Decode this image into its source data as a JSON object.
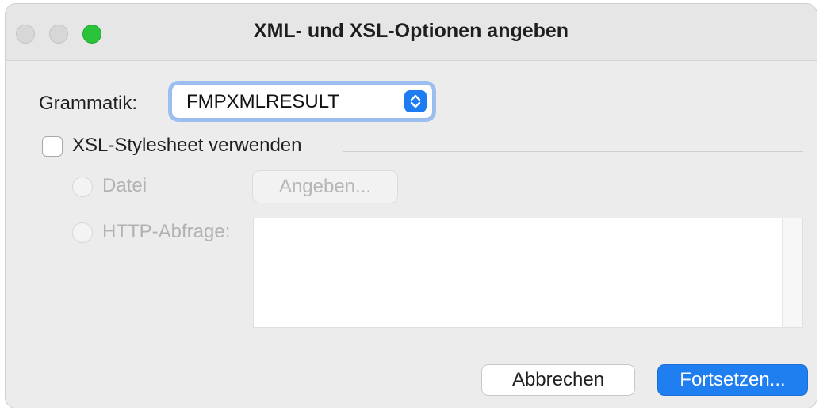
{
  "window": {
    "title": "XML- und XSL-Optionen angeben"
  },
  "grammar": {
    "label": "Grammatik:",
    "selected": "FMPXMLRESULT"
  },
  "xsl": {
    "checkbox_label": "XSL-Stylesheet verwenden",
    "checked": false,
    "file_radio_label": "Datei",
    "specify_button": "Angeben...",
    "http_radio_label": "HTTP-Abfrage:",
    "http_query_value": ""
  },
  "buttons": {
    "cancel": "Abbrechen",
    "continue": "Fortsetzen..."
  },
  "colors": {
    "accent": "#1f7ef0",
    "disabled_text": "#b2b2b2"
  }
}
